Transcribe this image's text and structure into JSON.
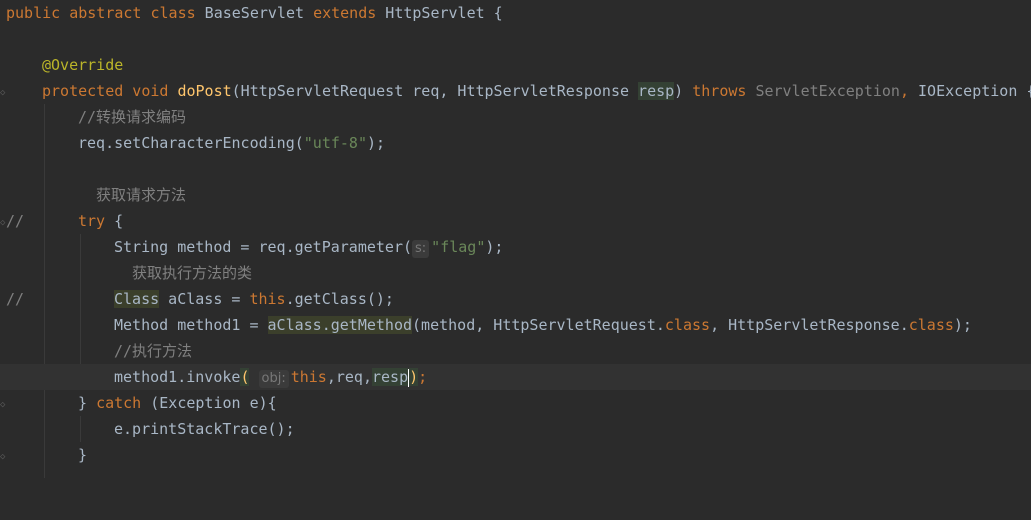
{
  "code": {
    "l1": {
      "kw1": "public abstract class",
      "name": " BaseServlet ",
      "kw2": "extends",
      "rest": " HttpServlet {"
    },
    "l3": {
      "annotation": "@Override"
    },
    "l4": {
      "kw1": "protected void ",
      "fn": "doPost",
      "p1": "(HttpServletRequest req, HttpServletResponse ",
      "resp": "resp",
      ") ": ") ",
      "throws": "throws ",
      "ex1": "ServletException",
      ", ": ", ",
      "ex2": "IOException {"
    },
    "l5": {
      "comment": "//转换请求编码"
    },
    "l6": {
      "a": "req.setCharacterEncoding(",
      "str": "\"utf-8\"",
      "b": ");"
    },
    "l8": {
      "gutter": "//",
      "text": "获取请求方法"
    },
    "l9": {
      "kw": "try",
      "rest": " {"
    },
    "l10": {
      "a": "String method = req.getParameter(",
      "hint": "s:",
      "str": "\"flag\"",
      "b": ");"
    },
    "l11": {
      "gutter": "//",
      "text": "获取执行方法的类"
    },
    "l12": {
      "cls": "Class",
      "a": " aClass = ",
      "kw": "this",
      ".": ".getClass();"
    },
    "l13": {
      "a": "Method method1 = ",
      "hl": "aClass.getMethod",
      "b": "(method, HttpServletRequest.",
      "kw1": "class",
      ", ": ", HttpServletResponse.",
      "kw2": "class",
      "c": ");"
    },
    "l14": {
      "comment": "//执行方法"
    },
    "l15": {
      "a": "method1.invoke",
      "paren": "(",
      "hint": "obj:",
      "kw": "this",
      ",": ",req,",
      "resp": "resp",
      "close": ")",
      ";": ";"
    },
    "l16": {
      "a": "} ",
      "kw": "catch",
      "b": " (Exception e){"
    },
    "l17": {
      "a": "e.printStackTrace();"
    },
    "l18": {
      "a": "}"
    }
  },
  "icons": {
    "bulb": "lightbulb-icon",
    "fold": "fold-marker-icon"
  }
}
